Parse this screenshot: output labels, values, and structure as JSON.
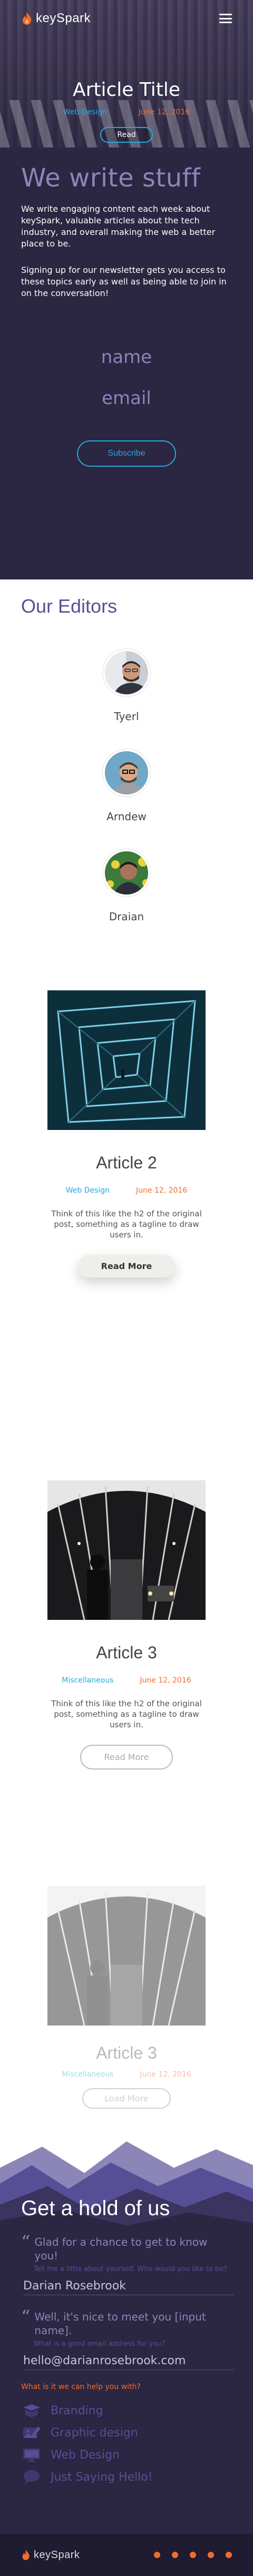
{
  "header": {
    "brand": "keySpark",
    "menu_icon": "hamburger-icon",
    "logo_icon": "flame-icon"
  },
  "hero": {
    "title": "Article Title",
    "category": "Web Design",
    "date": "June 12, 2016",
    "read_label": "Read"
  },
  "about": {
    "heading": "We write stuff",
    "paragraph1": "We write engaging content each week about keySpark, valuable articles about the tech industry, and overall making the web a better place to be.",
    "paragraph2": "Signing up for our newsletter gets you access to these topics early as well as being able to join in on the conversation!",
    "name_placeholder": "name",
    "email_placeholder": "email",
    "subscribe_label": "Subscribe"
  },
  "editors": {
    "heading": "Our Editors",
    "items": [
      {
        "name": "Tyerl"
      },
      {
        "name": "Arndew"
      },
      {
        "name": "Draian"
      }
    ]
  },
  "articles": [
    {
      "title": "Article 2",
      "category": "Web Design",
      "date": "June 12, 2016",
      "excerpt": "Think of this like the h2 of the original post, something as a tagline to draw users in.",
      "button": "Read More"
    },
    {
      "title": "Article 3",
      "category": "Miscellaneous",
      "date": "June 12, 2016",
      "excerpt": "Think of this like the h2 of the original post, something as a tagline to draw users in.",
      "button": "Read More"
    },
    {
      "title": "Article 3",
      "category": "Miscellaneous",
      "date": "June 12, 2016",
      "button": "Load More"
    }
  ],
  "contact": {
    "heading": "Get a hold of us",
    "q1": "Glad for a chance to get to know you!",
    "q1_sub": "Tell me a little about yourself. Who would you like to be?",
    "q1_answer": "Darian Rosebrook",
    "q2": "Well, it's nice to meet you [input name].",
    "q2_sub": "What is a good email address for you?",
    "q2_answer": "hello@darianrosebrook.com",
    "help_prompt": "What is it we can help you with?",
    "options": [
      {
        "label": "Branding",
        "icon": "branding-icon"
      },
      {
        "label": "Graphic design",
        "icon": "graphic-design-icon"
      },
      {
        "label": "Web Design",
        "icon": "web-design-icon"
      },
      {
        "label": "Just Saying Hello!",
        "icon": "chat-bubble-icon"
      }
    ]
  },
  "footer": {
    "brand": "keySpark",
    "socials": [
      "twitter-icon",
      "dribbble-icon",
      "github-icon",
      "instagram-icon",
      "linkedin-icon"
    ]
  },
  "colors": {
    "primary_dark": "#2b2641",
    "accent_purple": "#8b85b8",
    "accent_blue": "#27a9e1",
    "accent_orange": "#f26c2c"
  }
}
